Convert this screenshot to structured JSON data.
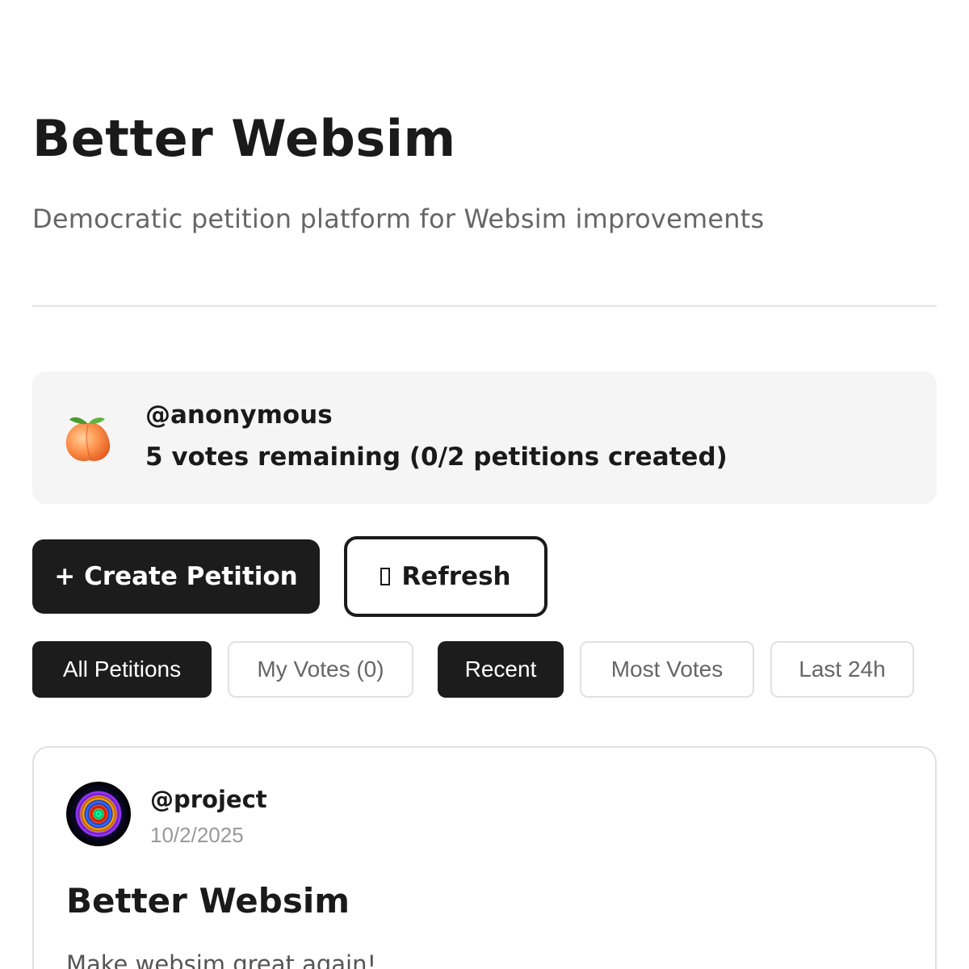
{
  "header": {
    "title": "Better Websim",
    "subtitle": "Democratic petition platform for Websim improvements"
  },
  "user": {
    "avatar_icon": "peach-emoji-icon",
    "username": "@anonymous",
    "status": "5 votes remaining (0/2 petitions created)"
  },
  "actions": {
    "create_label": "+ Create Petition",
    "refresh_label": "Refresh",
    "refresh_icon": "missing-glyph-icon"
  },
  "filters": {
    "scope": [
      {
        "label": "All Petitions",
        "active": true
      },
      {
        "label": "My Votes (0)",
        "active": false
      }
    ],
    "sort": [
      {
        "label": "Recent",
        "active": true
      },
      {
        "label": "Most Votes",
        "active": false
      },
      {
        "label": "Last 24h",
        "active": false
      }
    ]
  },
  "petitions": [
    {
      "author": "@project",
      "date": "10/2/2025",
      "title": "Better Websim",
      "description": "Make websim great again!"
    }
  ],
  "colors": {
    "primary_dark": "#1c1c1c",
    "muted_text": "#666666",
    "card_background": "#f5f5f5",
    "border": "#e1e1e1"
  }
}
